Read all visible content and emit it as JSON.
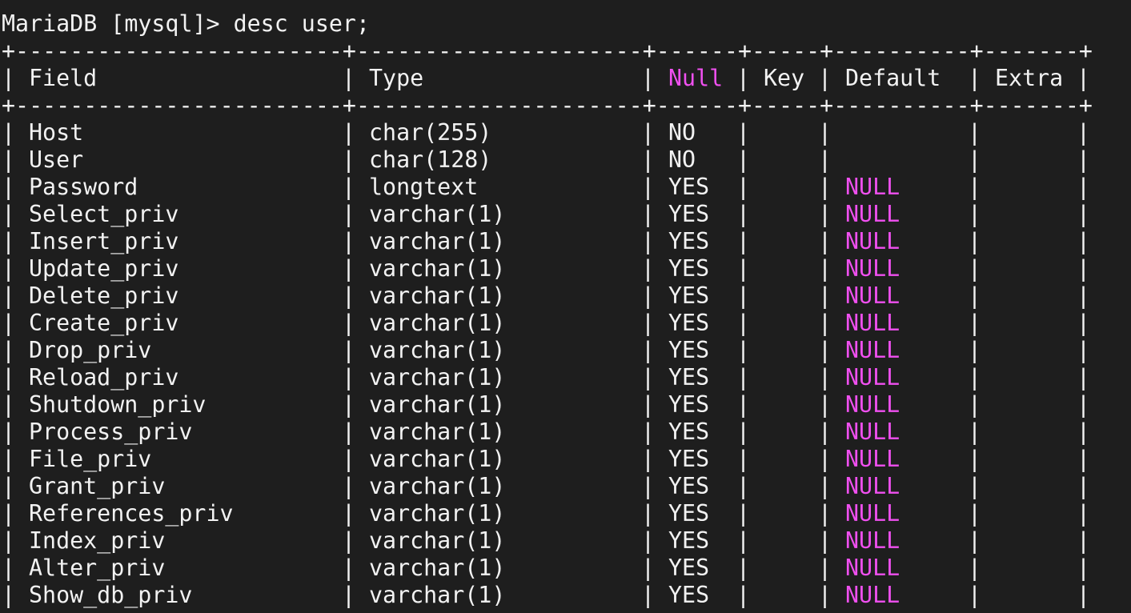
{
  "prompt": "MariaDB [mysql]> desc user;",
  "border_line": "+------------------------+---------------------+------+-----+----------+-------+",
  "columns": [
    "Field",
    "Type",
    "Null",
    "Key",
    "Default",
    "Extra"
  ],
  "rows": [
    {
      "field": "Host",
      "type": "char(255)",
      "null": "NO",
      "key": "",
      "default": "",
      "extra": ""
    },
    {
      "field": "User",
      "type": "char(128)",
      "null": "NO",
      "key": "",
      "default": "",
      "extra": ""
    },
    {
      "field": "Password",
      "type": "longtext",
      "null": "YES",
      "key": "",
      "default": "NULL",
      "extra": ""
    },
    {
      "field": "Select_priv",
      "type": "varchar(1)",
      "null": "YES",
      "key": "",
      "default": "NULL",
      "extra": ""
    },
    {
      "field": "Insert_priv",
      "type": "varchar(1)",
      "null": "YES",
      "key": "",
      "default": "NULL",
      "extra": ""
    },
    {
      "field": "Update_priv",
      "type": "varchar(1)",
      "null": "YES",
      "key": "",
      "default": "NULL",
      "extra": ""
    },
    {
      "field": "Delete_priv",
      "type": "varchar(1)",
      "null": "YES",
      "key": "",
      "default": "NULL",
      "extra": ""
    },
    {
      "field": "Create_priv",
      "type": "varchar(1)",
      "null": "YES",
      "key": "",
      "default": "NULL",
      "extra": ""
    },
    {
      "field": "Drop_priv",
      "type": "varchar(1)",
      "null": "YES",
      "key": "",
      "default": "NULL",
      "extra": ""
    },
    {
      "field": "Reload_priv",
      "type": "varchar(1)",
      "null": "YES",
      "key": "",
      "default": "NULL",
      "extra": ""
    },
    {
      "field": "Shutdown_priv",
      "type": "varchar(1)",
      "null": "YES",
      "key": "",
      "default": "NULL",
      "extra": ""
    },
    {
      "field": "Process_priv",
      "type": "varchar(1)",
      "null": "YES",
      "key": "",
      "default": "NULL",
      "extra": ""
    },
    {
      "field": "File_priv",
      "type": "varchar(1)",
      "null": "YES",
      "key": "",
      "default": "NULL",
      "extra": ""
    },
    {
      "field": "Grant_priv",
      "type": "varchar(1)",
      "null": "YES",
      "key": "",
      "default": "NULL",
      "extra": ""
    },
    {
      "field": "References_priv",
      "type": "varchar(1)",
      "null": "YES",
      "key": "",
      "default": "NULL",
      "extra": ""
    },
    {
      "field": "Index_priv",
      "type": "varchar(1)",
      "null": "YES",
      "key": "",
      "default": "NULL",
      "extra": ""
    },
    {
      "field": "Alter_priv",
      "type": "varchar(1)",
      "null": "YES",
      "key": "",
      "default": "NULL",
      "extra": ""
    },
    {
      "field": "Show_db_priv",
      "type": "varchar(1)",
      "null": "YES",
      "key": "",
      "default": "NULL",
      "extra": ""
    }
  ],
  "colors": {
    "background": "#1e1e1e",
    "text": "#f2f2f2",
    "highlight": "#f050f0"
  }
}
